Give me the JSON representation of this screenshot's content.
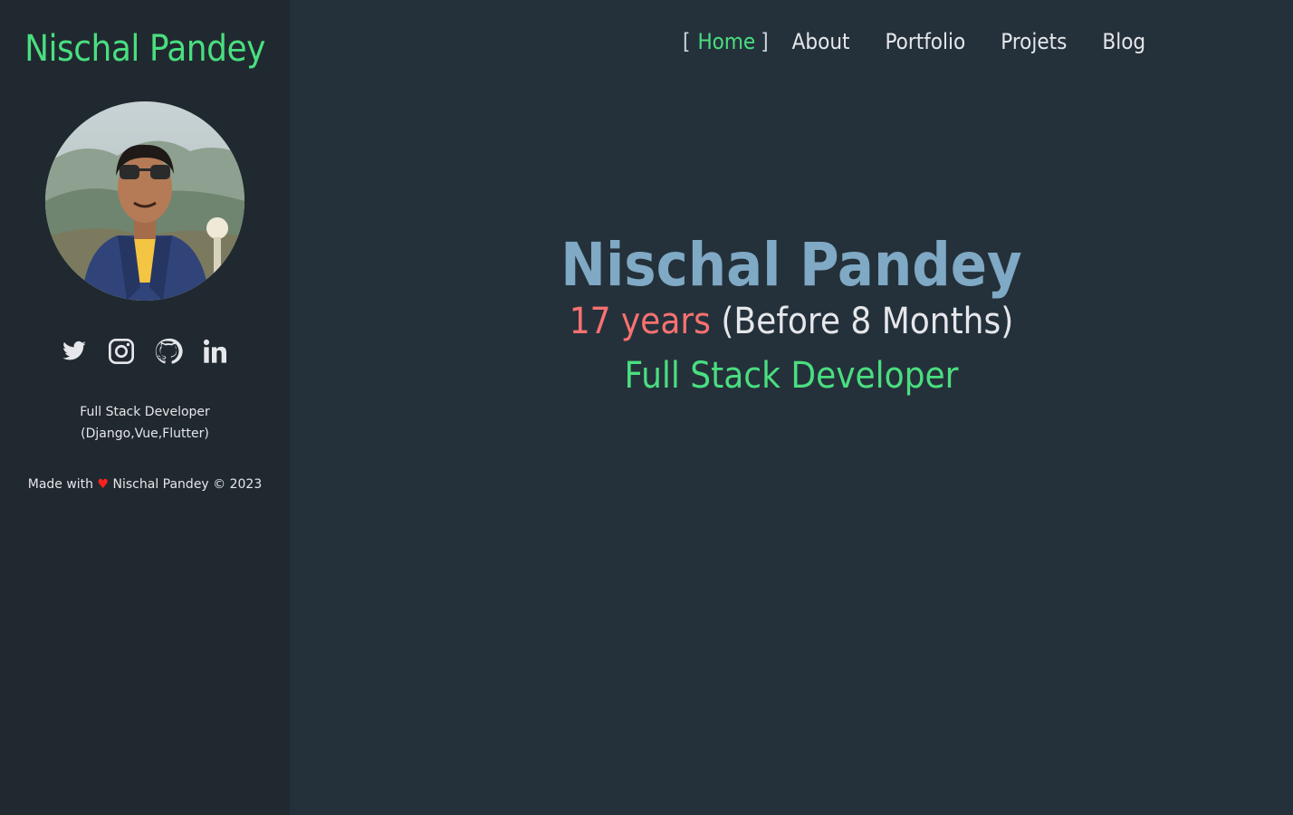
{
  "colors": {
    "background": "#24313a",
    "sidebar_background": "#20292f",
    "accent_green": "#4ade80",
    "hero_name": "#7fa9c4",
    "age_highlight": "#f87171",
    "text": "#e5e7eb",
    "heart": "#ff2020"
  },
  "sidebar": {
    "brand": "Nischal Pandey",
    "socials": [
      {
        "icon": "twitter-icon",
        "label": "Twitter"
      },
      {
        "icon": "instagram-icon",
        "label": "Instagram"
      },
      {
        "icon": "github-icon",
        "label": "GitHub"
      },
      {
        "icon": "linkedin-icon",
        "label": "LinkedIn"
      }
    ],
    "tagline_line1": "Full Stack Developer",
    "tagline_line2": "(Django,Vue,Flutter)",
    "footer": {
      "made_with": "Made with",
      "heart": "♥",
      "owner": "Nischal Pandey © 2023"
    }
  },
  "nav": {
    "bracket_open": "[",
    "bracket_close": "]",
    "items": [
      {
        "label": "Home",
        "active": true
      },
      {
        "label": "About"
      },
      {
        "label": "Portfolio"
      },
      {
        "label": "Projets"
      },
      {
        "label": "Blog"
      }
    ]
  },
  "hero": {
    "name": "Nischal Pandey",
    "age_years": "17 years",
    "age_note": "(Before 8 Months)",
    "role": "Full Stack Developer"
  }
}
